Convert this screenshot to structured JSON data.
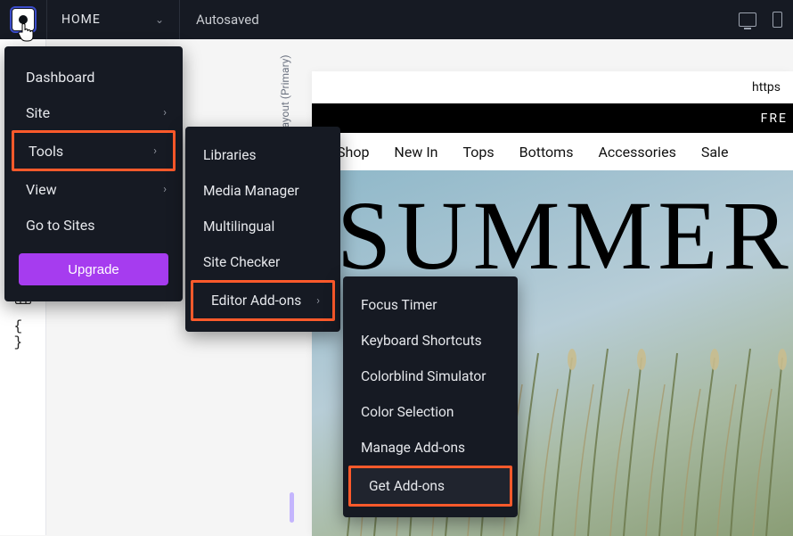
{
  "topbar": {
    "page_label": "HOME",
    "status": "Autosaved"
  },
  "left_rail": {
    "table_icon": "▦",
    "braces_icon": "{ }"
  },
  "layout_label": "Layout (Primary)",
  "menu": {
    "dashboard": "Dashboard",
    "site": "Site",
    "tools": "Tools",
    "view": "View",
    "go_to_sites": "Go to Sites",
    "upgrade": "Upgrade"
  },
  "tools_submenu": {
    "libraries": "Libraries",
    "media_manager": "Media Manager",
    "multilingual": "Multilingual",
    "site_checker": "Site Checker",
    "editor_addons": "Editor Add-ons"
  },
  "addons_submenu": {
    "focus_timer": "Focus Timer",
    "keyboard_shortcuts": "Keyboard Shortcuts",
    "colorblind_simulator": "Colorblind Simulator",
    "color_selection": "Color Selection",
    "manage_addons": "Manage Add-ons",
    "get_addons": "Get Add-ons"
  },
  "preview": {
    "url_fragment": "https",
    "promo_fragment": "FRE",
    "nav": [
      "Shop",
      "New In",
      "Tops",
      "Bottoms",
      "Accessories",
      "Sale"
    ],
    "hero_title": "SUMMER"
  }
}
